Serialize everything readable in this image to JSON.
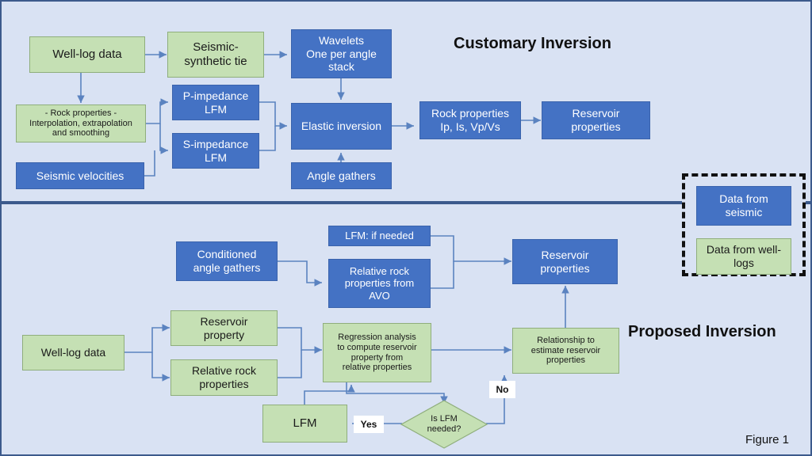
{
  "figure": {
    "caption": "Figure 1",
    "background_color": "#D9E2F3",
    "border_color": "#3C5A8C",
    "seismic_color": "#4472C4",
    "welllog_color": "#C5E0B4",
    "connector_color": "#5B83C0"
  },
  "sections": {
    "top": {
      "title": "Customary Inversion"
    },
    "bottom": {
      "title": "Proposed Inversion"
    }
  },
  "legend": {
    "items": [
      {
        "label": "Data from seismic",
        "type": "seismic"
      },
      {
        "label": "Data from well-logs",
        "type": "well-logs"
      }
    ]
  },
  "customary": {
    "nodes": [
      {
        "id": "well-log-data",
        "label": "Well-log data",
        "type": "well-logs"
      },
      {
        "id": "seismic-synthetic-tie",
        "label": "Seismic-\nsynthetic tie",
        "type": "well-logs"
      },
      {
        "id": "wavelets",
        "label": "Wavelets\nOne per angle\nstack",
        "type": "seismic"
      },
      {
        "id": "rock-properties-interp",
        "label": "- Rock properties -\nInterpolation,  extrapolation\nand smoothing",
        "type": "well-logs"
      },
      {
        "id": "p-impedance-lfm",
        "label": "P-impedance\nLFM",
        "type": "seismic"
      },
      {
        "id": "s-impedance-lfm",
        "label": "S-impedance\nLFM",
        "type": "seismic"
      },
      {
        "id": "seismic-velocities",
        "label": "Seismic velocities",
        "type": "seismic"
      },
      {
        "id": "elastic-inversion",
        "label": "Elastic inversion",
        "type": "seismic"
      },
      {
        "id": "angle-gathers",
        "label": "Angle gathers",
        "type": "seismic"
      },
      {
        "id": "rock-properties-ip",
        "label": "Rock properties\nIp, Is, Vp/Vs",
        "type": "seismic"
      },
      {
        "id": "reservoir-properties-top",
        "label": "Reservoir\nproperties",
        "type": "seismic"
      }
    ]
  },
  "proposed": {
    "nodes": [
      {
        "id": "conditioned-angle-gathers",
        "label": "Conditioned\nangle gathers",
        "type": "seismic"
      },
      {
        "id": "lfm-if-needed",
        "label": "LFM: if needed",
        "type": "seismic"
      },
      {
        "id": "relative-rock-properties-avo",
        "label": "Relative rock\nproperties from\nAVO",
        "type": "seismic"
      },
      {
        "id": "reservoir-properties-bottom",
        "label": "Reservoir\nproperties",
        "type": "seismic"
      },
      {
        "id": "well-log-data-2",
        "label": "Well-log data",
        "type": "well-logs"
      },
      {
        "id": "reservoir-property",
        "label": "Reservoir\nproperty",
        "type": "well-logs"
      },
      {
        "id": "relative-rock-properties",
        "label": "Relative  rock\nproperties",
        "type": "well-logs"
      },
      {
        "id": "regression-analysis",
        "label": "Regression analysis\nto compute  reservoir\nproperty  from\nrelative properties",
        "type": "well-logs"
      },
      {
        "id": "relationship-estimate",
        "label": "Relationship to\nestimate reservoir\nproperties",
        "type": "well-logs"
      },
      {
        "id": "lfm",
        "label": "LFM",
        "type": "well-logs"
      },
      {
        "id": "is-lfm-needed",
        "label": "Is LFM\nneeded?",
        "type": "decision"
      }
    ],
    "edge_labels": [
      {
        "id": "yes-label",
        "label": "Yes"
      },
      {
        "id": "no-label",
        "label": "No"
      }
    ]
  }
}
